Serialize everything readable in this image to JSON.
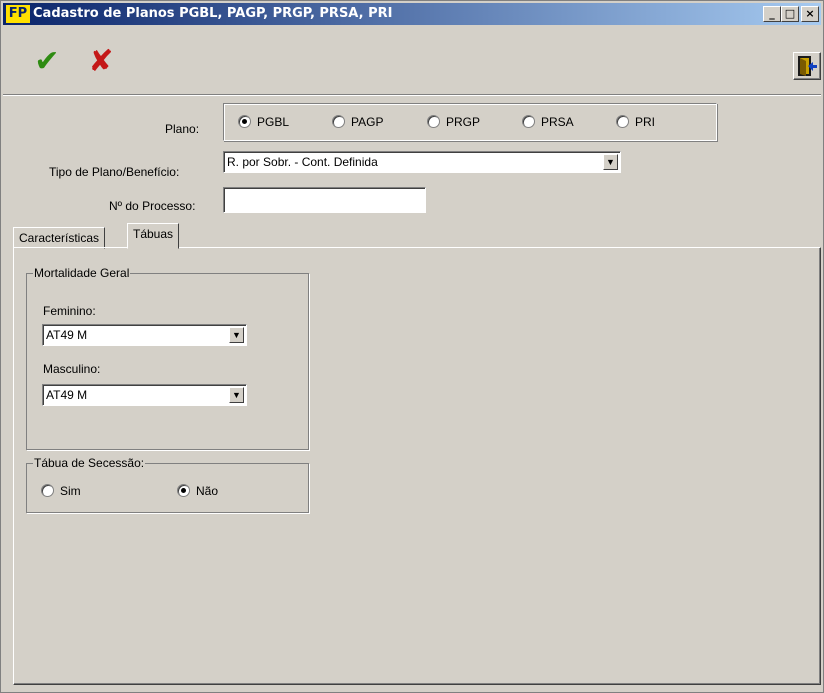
{
  "window": {
    "icon_text": "FP",
    "title": "Cadastro de Planos PGBL, PAGP, PRGP, PRSA, PRI",
    "min_glyph": "_",
    "max_glyph": "□",
    "close_glyph": "×"
  },
  "toolbar": {
    "confirm_glyph": "✔",
    "cancel_glyph": "✘",
    "colors": {
      "confirm": "#2e8b12",
      "cancel": "#c41818"
    }
  },
  "form": {
    "plano_label": "Plano:",
    "plano_options": [
      {
        "label": "PGBL",
        "selected": true
      },
      {
        "label": "PAGP",
        "selected": false
      },
      {
        "label": "PRGP",
        "selected": false
      },
      {
        "label": "PRSA",
        "selected": false
      },
      {
        "label": "PRI",
        "selected": false
      }
    ],
    "tipo_label": "Tipo de Plano/Benefício:",
    "tipo_value": "R. por Sobr. - Cont. Definida",
    "processo_label": "Nº do Processo:",
    "processo_value": ""
  },
  "tabs": [
    {
      "label": "Características",
      "active": false
    },
    {
      "label": "Tábuas",
      "active": true
    }
  ],
  "tabuas": {
    "mortalidade_title": "Mortalidade Geral",
    "feminino_label": "Feminino:",
    "feminino_value": "AT49 M",
    "masculino_label": "Masculino:",
    "masculino_value": "AT49 M",
    "secessao_title": "Tábua de Secessão:",
    "secessao_options": [
      {
        "label": "Sim",
        "selected": false
      },
      {
        "label": "Não",
        "selected": true
      }
    ]
  },
  "dropdown_glyph": "▼"
}
